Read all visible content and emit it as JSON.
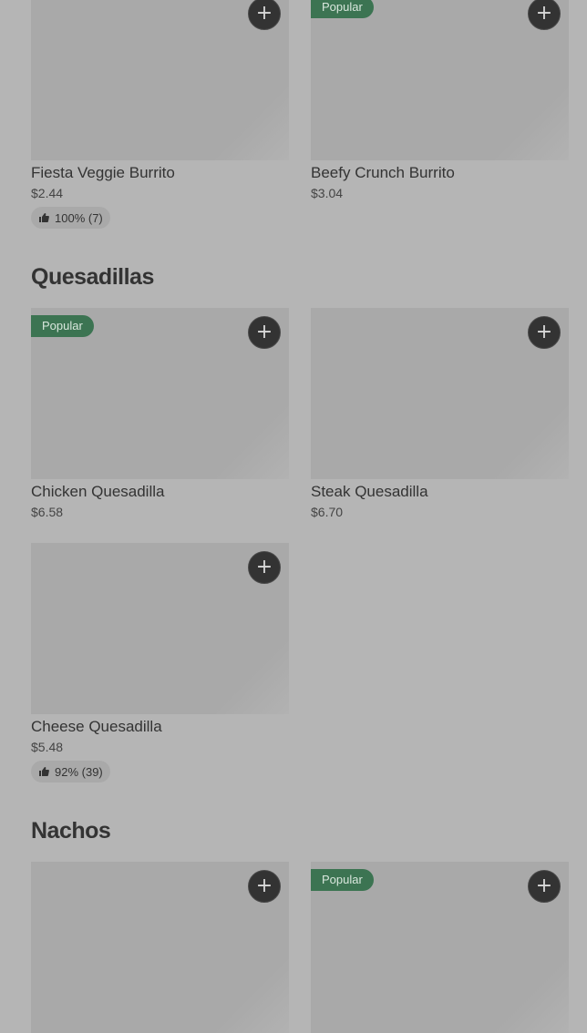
{
  "sections": [
    {
      "title": "",
      "items": [
        {
          "name": "Fiesta Veggie Burrito",
          "price": "$2.44",
          "badge": "",
          "rating": "100% (7)"
        },
        {
          "name": "Beefy Crunch Burrito",
          "price": "$3.04",
          "badge": "Popular",
          "rating": ""
        }
      ]
    },
    {
      "title": "Quesadillas",
      "items": [
        {
          "name": "Chicken Quesadilla",
          "price": "$6.58",
          "badge": "Popular",
          "rating": ""
        },
        {
          "name": "Steak Quesadilla",
          "price": "$6.70",
          "badge": "",
          "rating": ""
        },
        {
          "name": "Cheese Quesadilla",
          "price": "$5.48",
          "badge": "",
          "rating": "92% (39)"
        }
      ]
    },
    {
      "title": "Nachos",
      "items": [
        {
          "name": "",
          "price": "",
          "badge": "",
          "rating": ""
        },
        {
          "name": "",
          "price": "",
          "badge": "Popular",
          "rating": ""
        }
      ]
    }
  ],
  "icons": {
    "add": "plus-icon",
    "rating": "thumbs-up-icon"
  },
  "colors": {
    "background": "#b5b5b5",
    "badge": "#3c7452",
    "add_button": "#333333"
  }
}
